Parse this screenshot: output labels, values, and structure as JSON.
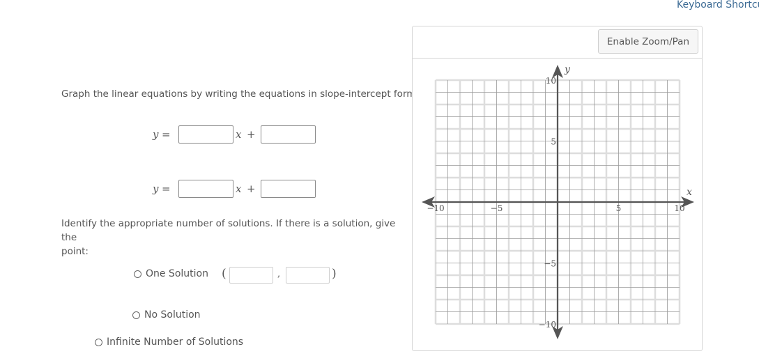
{
  "header": {
    "keyboard_shortcuts_link": "Keyboard Shortcu"
  },
  "instructions": {
    "graph_prompt": "Graph the linear equations by writing the equations in slope-intercept form:",
    "solutions_prompt_line1": "Identify the appropriate number of solutions. If there is a solution, give the",
    "solutions_prompt_line2": "point:"
  },
  "equations": [
    {
      "lhs": "y",
      "equals": "=",
      "x_var": "x",
      "plus": "+",
      "slope_value": "",
      "intercept_value": ""
    },
    {
      "lhs": "y",
      "equals": "=",
      "x_var": "x",
      "plus": "+",
      "slope_value": "",
      "intercept_value": ""
    }
  ],
  "solution_options": [
    {
      "label": "One Solution",
      "selected": false
    },
    {
      "label": "No Solution",
      "selected": false
    },
    {
      "label": "Infinite Number of Solutions",
      "selected": false
    }
  ],
  "point": {
    "open_paren": "(",
    "comma": ",",
    "close_paren": ")",
    "x_value": "",
    "y_value": ""
  },
  "graph": {
    "zoom_button_label": "Enable Zoom/Pan",
    "x_axis_label": "x",
    "y_axis_label": "y",
    "x_range": [
      -10,
      10
    ],
    "y_range": [
      -10,
      10
    ],
    "grid_step": 1,
    "x_ticks": [
      {
        "value": -10,
        "label": "−10"
      },
      {
        "value": -5,
        "label": "−5"
      },
      {
        "value": 5,
        "label": "5"
      },
      {
        "value": 10,
        "label": "10"
      }
    ],
    "y_ticks": [
      {
        "value": 10,
        "label": "10"
      },
      {
        "value": 5,
        "label": "5"
      },
      {
        "value": -5,
        "label": "−5"
      },
      {
        "value": -10,
        "label": "−10"
      }
    ],
    "colors": {
      "axis": "#555555",
      "grid_light": "#dddddd",
      "grid_dark": "#9a9a9a"
    }
  }
}
